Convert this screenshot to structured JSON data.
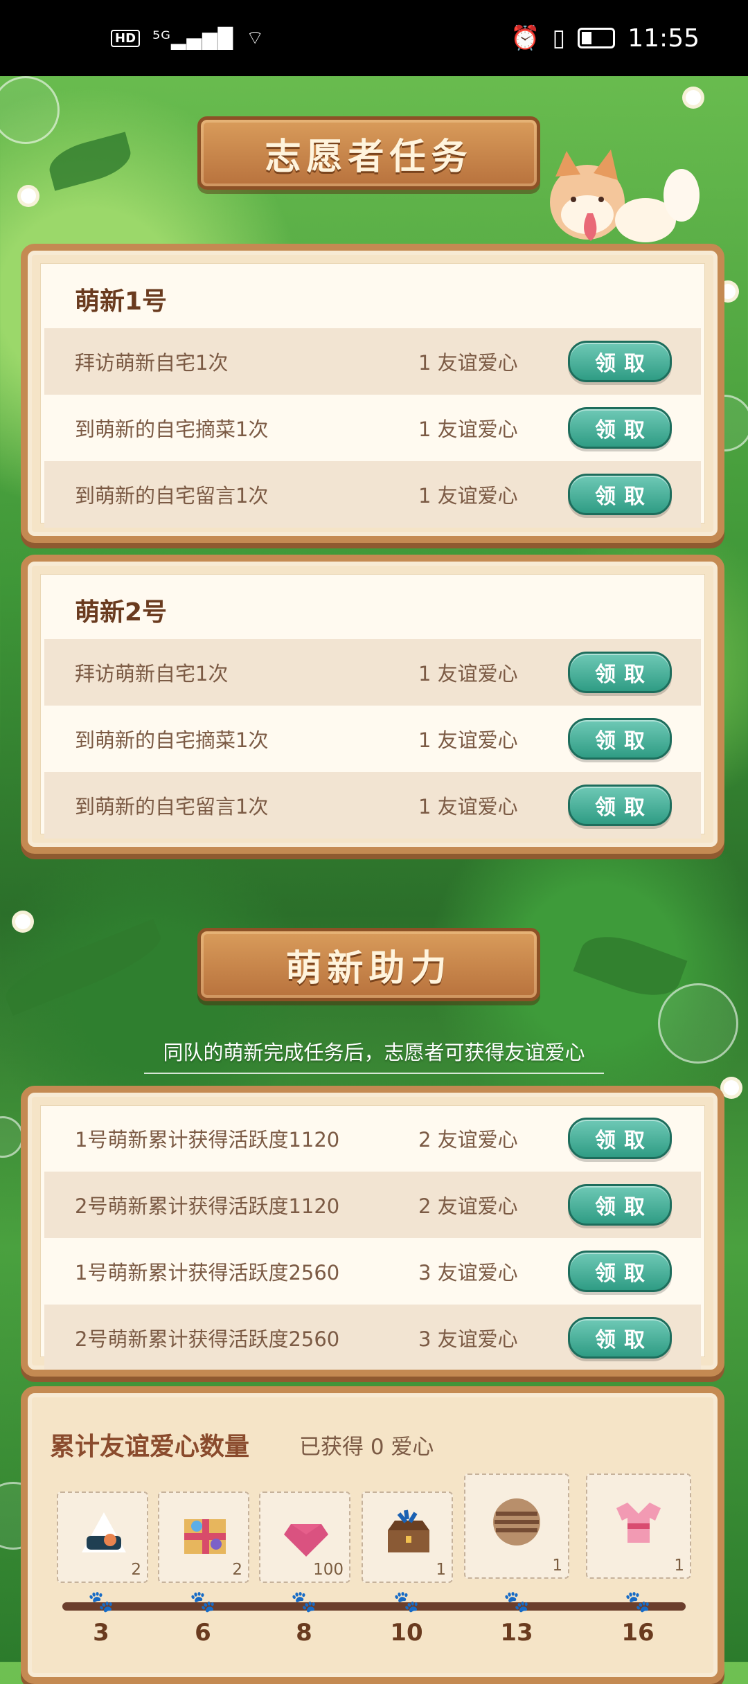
{
  "status_bar": {
    "hd": "HD",
    "signal": "⁵ᴳ▂▄▆█",
    "wifi": "⌔",
    "time": "11:55"
  },
  "headers": {
    "volunteer_tasks": "志愿者任务",
    "newbie_help": "萌新助力"
  },
  "panels": [
    {
      "title": "萌新1号",
      "rows": [
        {
          "task": "拜访萌新自宅1次",
          "reward": "1 友谊爱心",
          "button": "领取"
        },
        {
          "task": "到萌新的自宅摘菜1次",
          "reward": "1 友谊爱心",
          "button": "领取"
        },
        {
          "task": "到萌新的自宅留言1次",
          "reward": "1 友谊爱心",
          "button": "领取"
        }
      ]
    },
    {
      "title": "萌新2号",
      "rows": [
        {
          "task": "拜访萌新自宅1次",
          "reward": "1 友谊爱心",
          "button": "领取"
        },
        {
          "task": "到萌新的自宅摘菜1次",
          "reward": "1 友谊爱心",
          "button": "领取"
        },
        {
          "task": "到萌新的自宅留言1次",
          "reward": "1 友谊爱心",
          "button": "领取"
        }
      ]
    }
  ],
  "notice": "同队的萌新完成任务后，志愿者可获得友谊爱心",
  "help_rows": [
    {
      "task": "1号萌新累计获得活跃度1120",
      "reward": "2 友谊爱心",
      "button": "领取"
    },
    {
      "task": "2号萌新累计获得活跃度1120",
      "reward": "2 友谊爱心",
      "button": "领取"
    },
    {
      "task": "1号萌新累计获得活跃度2560",
      "reward": "3 友谊爱心",
      "button": "领取"
    },
    {
      "task": "2号萌新累计获得活跃度2560",
      "reward": "3 友谊爱心",
      "button": "领取"
    }
  ],
  "summary": {
    "title": "累计友谊爱心数量",
    "obtained": "已获得 0 爱心",
    "rewards": [
      {
        "count": "2",
        "icon": "rice-ball-icon"
      },
      {
        "count": "2",
        "icon": "gift-box-icon"
      },
      {
        "count": "100",
        "icon": "gem-icon"
      },
      {
        "count": "1",
        "icon": "treasure-chest-icon"
      },
      {
        "count": "1",
        "icon": "planet-icon"
      },
      {
        "count": "1",
        "icon": "kimono-icon"
      }
    ],
    "milestones": [
      "3",
      "6",
      "8",
      "10",
      "13",
      "16"
    ]
  }
}
